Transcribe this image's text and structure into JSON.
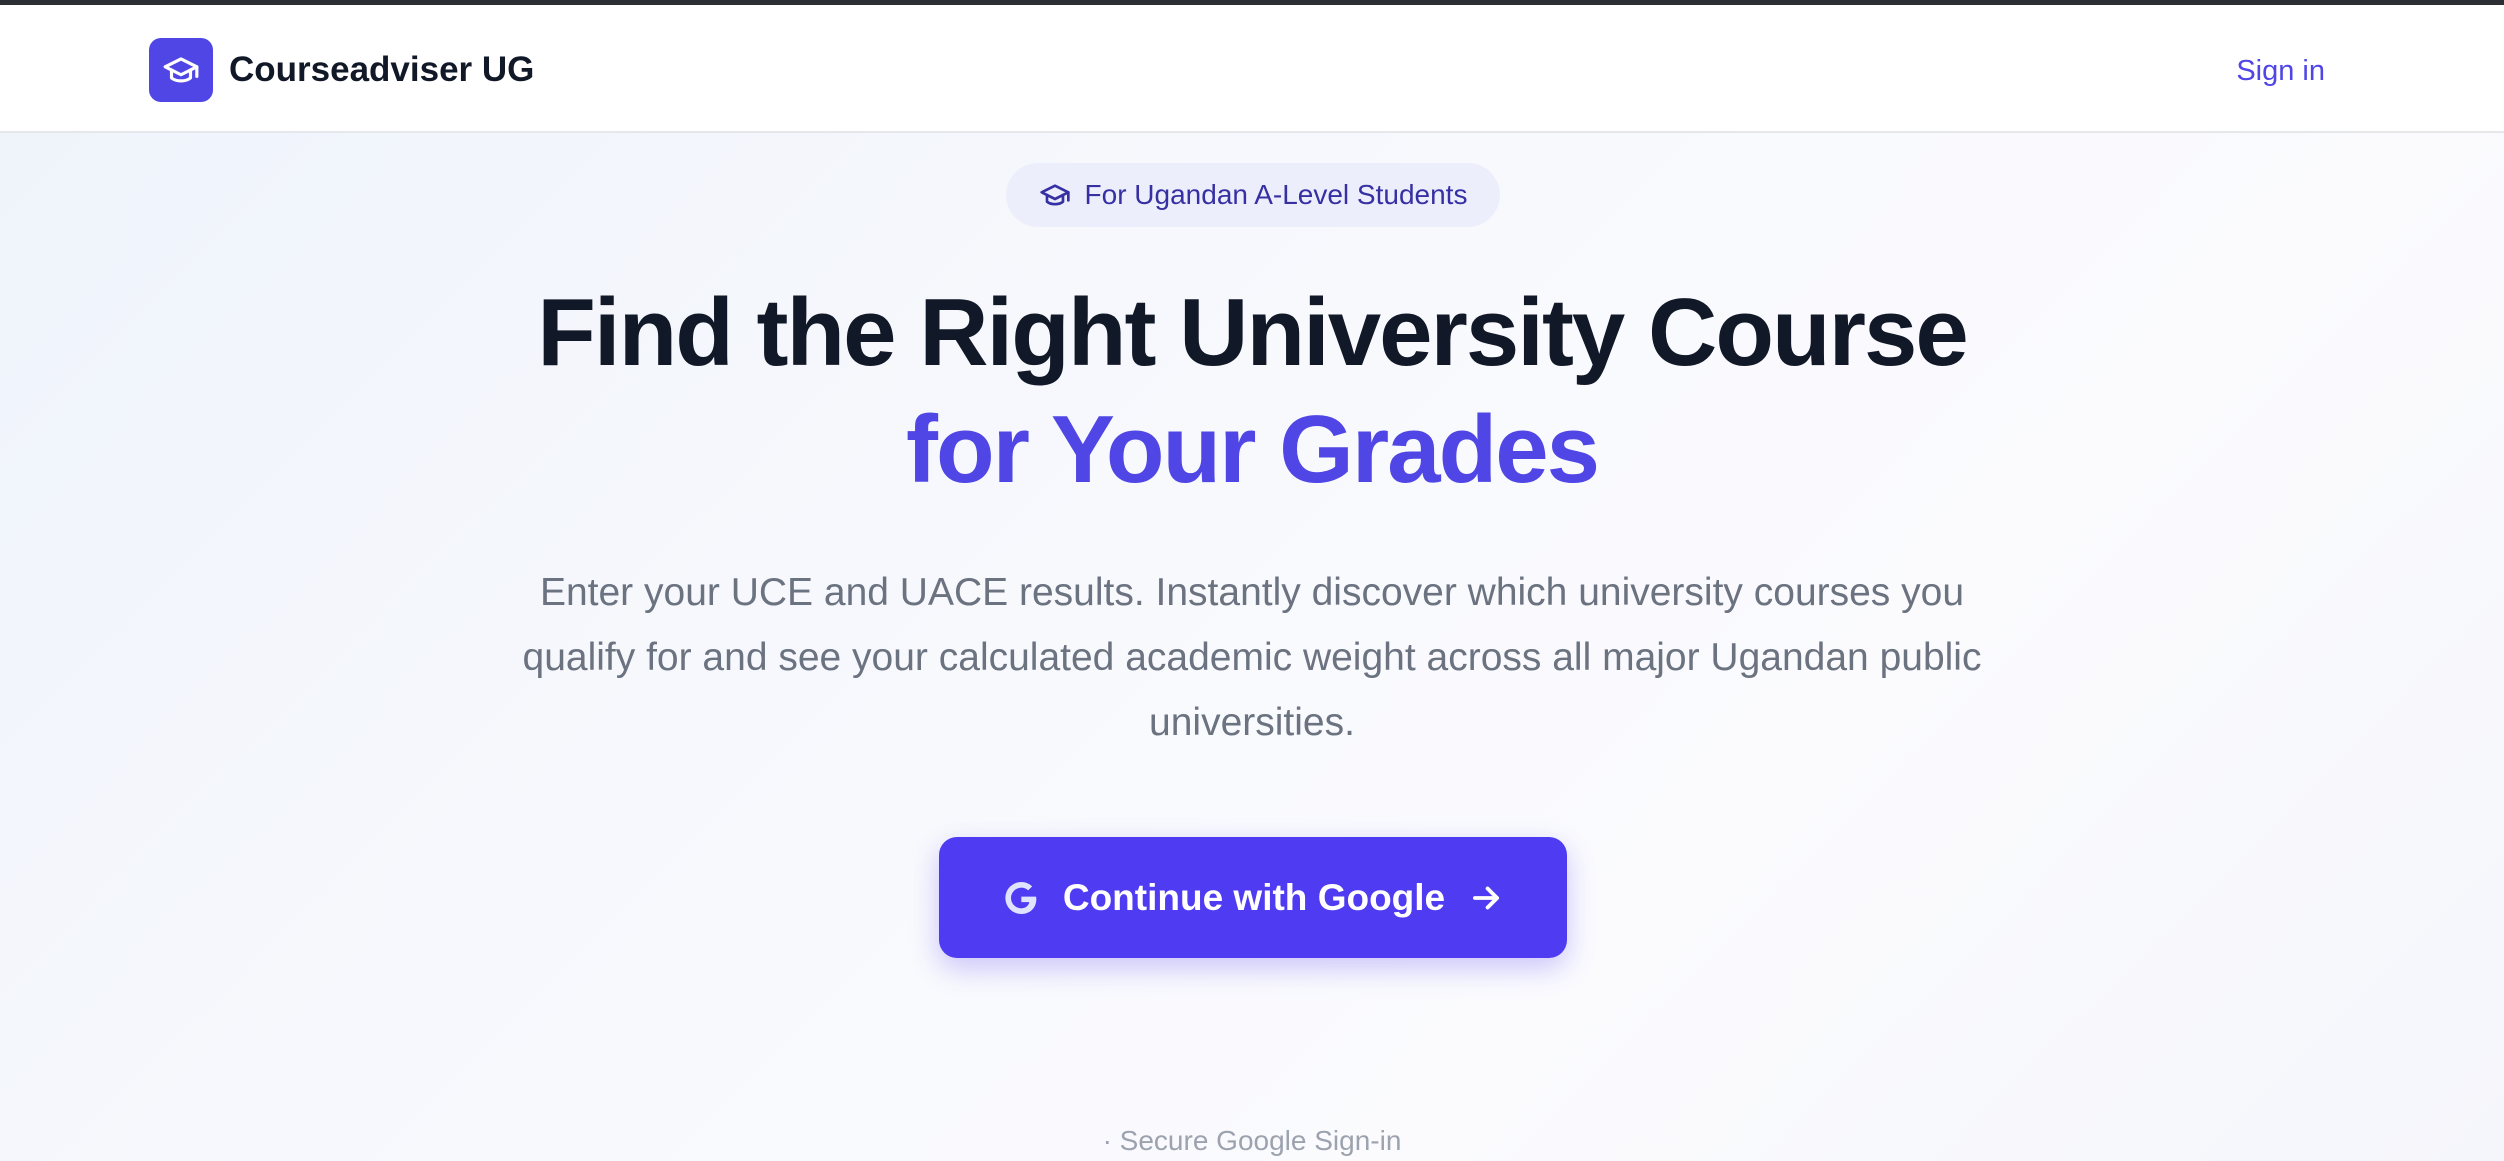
{
  "header": {
    "brand_name": "Courseadviser UG",
    "logo_icon": "graduation-cap-icon",
    "sign_in_label": "Sign in"
  },
  "hero": {
    "badge_icon": "graduation-cap-icon",
    "badge_text": "For Ugandan A-Level Students",
    "headline_line1": "Find the Right University Course",
    "headline_line2": "for Your Grades",
    "subtitle": "Enter your UCE and UACE results. Instantly discover which university courses you qualify for and see your calculated academic weight across all major Ugandan public universities.",
    "cta_label": "Continue with Google",
    "cta_leading_icon": "google-icon",
    "cta_trailing_icon": "arrow-right-icon",
    "secure_note": "· Secure Google Sign-in"
  },
  "colors": {
    "accent": "#4f46e5",
    "button": "#4f3bf2",
    "heading": "#111827",
    "muted": "#6b7280"
  }
}
